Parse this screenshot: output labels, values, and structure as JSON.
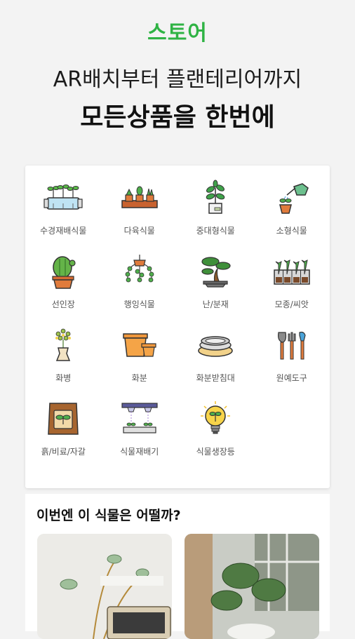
{
  "header": {
    "title": "스토어",
    "headline_line1": "AR배치부터 플랜테리어까지",
    "headline_line2": "모든상품을 한번에"
  },
  "categories": [
    {
      "label": "수경재배식물",
      "icon": "hydroponic-plant-icon"
    },
    {
      "label": "다육식물",
      "icon": "succulent-icon"
    },
    {
      "label": "중대형식물",
      "icon": "large-plant-icon"
    },
    {
      "label": "소형식물",
      "icon": "small-plant-icon"
    },
    {
      "label": "선인장",
      "icon": "cactus-icon"
    },
    {
      "label": "행잉식물",
      "icon": "hanging-plant-icon"
    },
    {
      "label": "난/분재",
      "icon": "bonsai-icon"
    },
    {
      "label": "모종/씨앗",
      "icon": "seedling-icon"
    },
    {
      "label": "화병",
      "icon": "vase-icon"
    },
    {
      "label": "화분",
      "icon": "flowerpot-icon"
    },
    {
      "label": "화분받침대",
      "icon": "pot-saucer-icon"
    },
    {
      "label": "원예도구",
      "icon": "garden-tools-icon"
    },
    {
      "label": "흙/비료/자갈",
      "icon": "soil-bag-icon"
    },
    {
      "label": "식물재배기",
      "icon": "grow-light-icon"
    },
    {
      "label": "식물생장등",
      "icon": "grow-bulb-icon"
    }
  ],
  "recommend": {
    "title": "이번엔 이 식물은 어떨까?"
  },
  "colors": {
    "accent": "#2fb344",
    "background": "#f3f3f3"
  }
}
